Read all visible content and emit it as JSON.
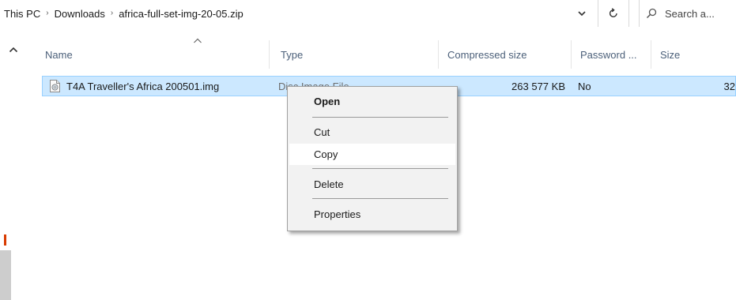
{
  "breadcrumb": {
    "items": [
      "This PC",
      "Downloads",
      "africa-full-set-img-20-05.zip"
    ]
  },
  "search": {
    "placeholder": "Search a..."
  },
  "columns": [
    {
      "label": "Name"
    },
    {
      "label": "Type"
    },
    {
      "label": "Compressed size"
    },
    {
      "label": "Password ..."
    },
    {
      "label": "Size"
    }
  ],
  "files": [
    {
      "name": "T4A Traveller's Africa 200501.img",
      "type": "Disc Image File",
      "compressed_size": "263 577 KB",
      "password": "No",
      "size": "32"
    }
  ],
  "context_menu": {
    "items": [
      "Open",
      "Cut",
      "Copy",
      "Delete",
      "Properties"
    ]
  },
  "colors": {
    "selection_bg": "#cce8ff",
    "selection_border": "#99d1ff",
    "header_text": "#4c607a",
    "menu_bg": "#f2f2f2"
  },
  "icons": [
    "chevron-right-icon",
    "chevron-down-icon",
    "refresh-icon",
    "search-icon",
    "sort-up-icon",
    "disc-image-file-icon"
  ]
}
